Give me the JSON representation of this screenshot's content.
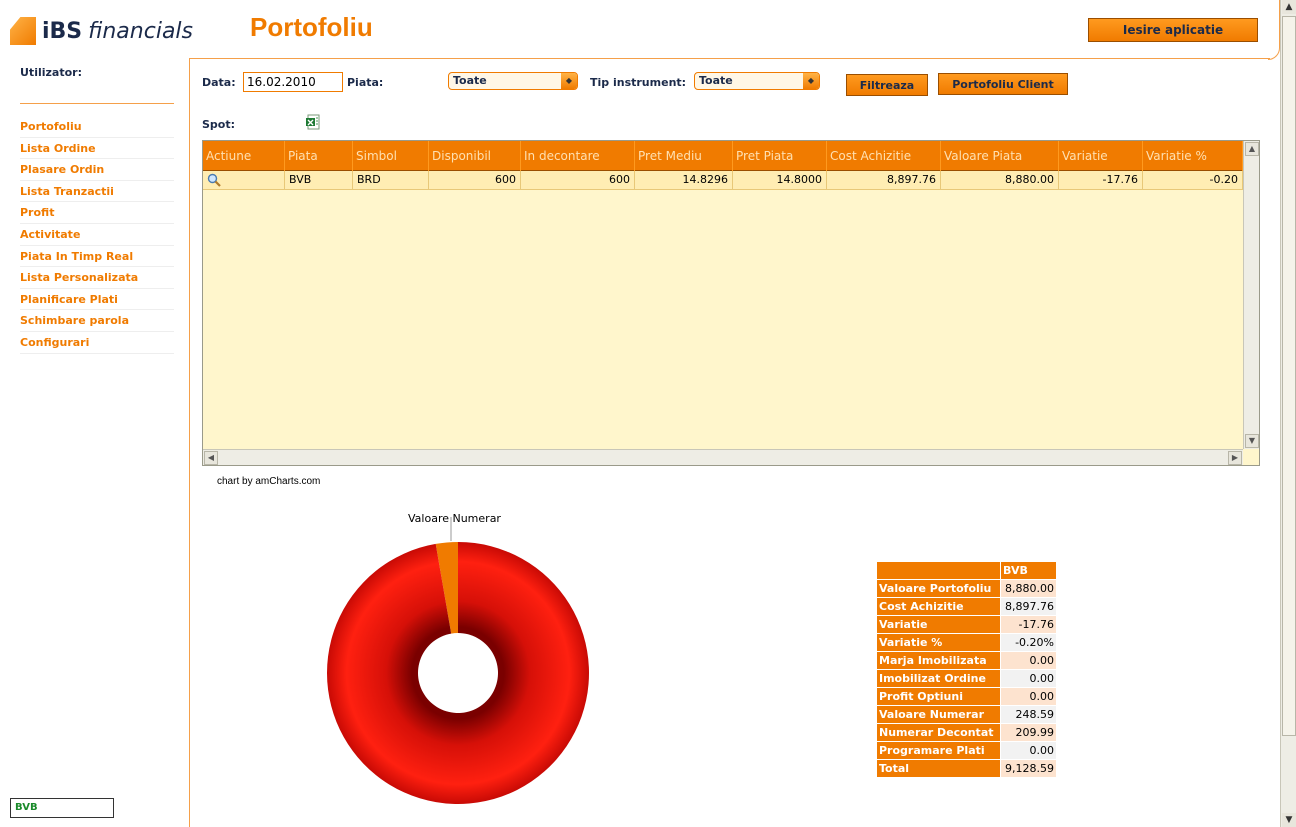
{
  "header": {
    "brand_bold": "iBS",
    "brand_italic": "financials",
    "title": "Portofoliu",
    "exit_label": "Iesire aplicatie"
  },
  "sidebar": {
    "user_label": "Utilizator:",
    "items": [
      "Portofoliu",
      "Lista Ordine",
      "Plasare Ordin",
      "Lista Tranzactii",
      "Profit",
      "Activitate",
      "Piata In Timp Real",
      "Lista Personalizata",
      "Planificare Plati",
      "Schimbare parola",
      "Configurari"
    ],
    "market_box": "BVB"
  },
  "filters": {
    "date_label": "Data:",
    "date_value": "16.02.2010",
    "market_label": "Piata:",
    "market_value": "Toate",
    "instrument_label": "Tip instrument:",
    "instrument_value": "Toate",
    "filter_button": "Filtreaza",
    "client_button": "Portofoliu Client",
    "spot_label": "Spot:"
  },
  "grid": {
    "columns": [
      "Actiune",
      "Piata",
      "Simbol",
      "Disponibil",
      "In decontare",
      "Pret Mediu",
      "Pret Piata",
      "Cost Achizitie",
      "Valoare Piata",
      "Variatie",
      "Variatie %"
    ],
    "rows": [
      {
        "market": "BVB",
        "symbol": "BRD",
        "available": "600",
        "settling": "600",
        "avg_price": "14.8296",
        "market_price": "14.8000",
        "cost": "8,897.76",
        "market_value": "8,880.00",
        "variation": "-17.76",
        "variation_pct": "-0.20"
      }
    ],
    "action_icon": "magnifier-icon"
  },
  "chart_credit": "chart by amCharts.com",
  "chart_data": {
    "type": "pie",
    "categories": [
      "Valoare Piata",
      "Valoare Numerar"
    ],
    "values": [
      8880.0,
      248.59
    ],
    "labels": [
      "",
      "Valoare Numerar"
    ],
    "colors": [
      "#e8140a",
      "#f07b00"
    ],
    "style": "donut-3d"
  },
  "summary": {
    "header": "BVB",
    "rows": [
      {
        "label": "Valoare Portofoliu",
        "value": "8,880.00"
      },
      {
        "label": "Cost Achizitie",
        "value": "8,897.76"
      },
      {
        "label": "Variatie",
        "value": "-17.76"
      },
      {
        "label": "Variatie %",
        "value": "-0.20%"
      },
      {
        "label": "Marja Imobilizata",
        "value": "0.00"
      },
      {
        "label": "Imobilizat Ordine",
        "value": "0.00"
      },
      {
        "label": "Profit Optiuni",
        "value": "0.00"
      },
      {
        "label": "Valoare Numerar",
        "value": "248.59"
      },
      {
        "label": "Numerar Decontat",
        "value": "209.99"
      },
      {
        "label": "Programare Plati",
        "value": "0.00"
      },
      {
        "label": "Total",
        "value": "9,128.59"
      }
    ]
  }
}
